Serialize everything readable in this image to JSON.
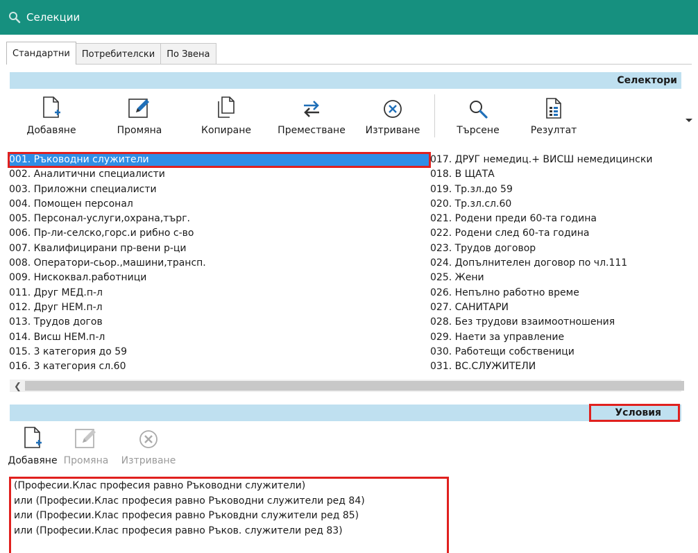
{
  "window": {
    "title": "Селекции"
  },
  "tabs": [
    {
      "label": "Стандартни",
      "active": true
    },
    {
      "label": "Потребителски",
      "active": false
    },
    {
      "label": "По Звена",
      "active": false
    }
  ],
  "selectors": {
    "header": "Селектори",
    "toolbar": {
      "add_label": "Добавяне",
      "edit_label": "Промяна",
      "copy_label": "Копиране",
      "move_label": "Преместване",
      "delete_label": "Изтриване",
      "search_label": "Търсене",
      "result_label": "Резултат"
    },
    "left_items": [
      "001. Ръководни служители",
      "002. Аналитични специалисти",
      "003. Приложни специалисти",
      "004. Помощен персонал",
      "005. Персонал-услуги,охрана,търг.",
      "006. Пр-ли-селско,горс.и рибно с-во",
      "007. Квалифицирани пр-вени р-ци",
      "008. Оператори-сьор.,машини,трансп.",
      "009. Нискоквал.работници",
      "011. Друг МЕД.п-л",
      "012. Друг НЕМ.п-л",
      "013. Трудов догов",
      "014. Висш НЕМ.п-л",
      "015. 3 категория до 59",
      "016. 3 категория  сл.60"
    ],
    "right_items": [
      "017. ДРУГ немедиц.+ ВИСШ немедицински",
      "018. В ЩАТА",
      "019. Тр.зл.до 59",
      "020. Тр.зл.сл.60",
      "021. Родени преди 60-та година",
      "022. Родени след 60-та година",
      "023. Трудов договор",
      "024. Допълнителен   договор по чл.111",
      "025. Жени",
      "026. Непълно работно време",
      "027. САНИТАРИ",
      "028. Без трудови взаимоотношения",
      "029. Наети за управление",
      "030. Работещи собственици",
      "031. ВС.СЛУЖИТЕЛИ"
    ],
    "selected_index": 0
  },
  "conditions": {
    "header": "Условия",
    "toolbar": {
      "add_label": "Добавяне",
      "edit_label": "Промяна",
      "delete_label": "Изтриване"
    },
    "lines": [
      " (Професии.Клас професия равно Ръководни служители)",
      "или (Професии.Клас професия равно Ръководни служители ред 84)",
      "или (Професии.Клас професия равно Ръковдни служители ред 85)",
      "или (Професии.Клас професия равно Ръков. служители ред 83)"
    ]
  },
  "colors": {
    "titlebar": "#16907f",
    "section_header": "#bfe0f0",
    "selection": "#2f8ee6",
    "highlight_border": "#e0201e",
    "icon_blue": "#1f6fb8"
  },
  "icons": {
    "window": "search-icon",
    "add": "document-add-icon",
    "edit": "pencil-icon",
    "copy": "copy-icon",
    "move": "swap-arrows-icon",
    "delete": "circle-x-icon",
    "search": "magnifier-icon",
    "result": "spreadsheet-icon"
  }
}
